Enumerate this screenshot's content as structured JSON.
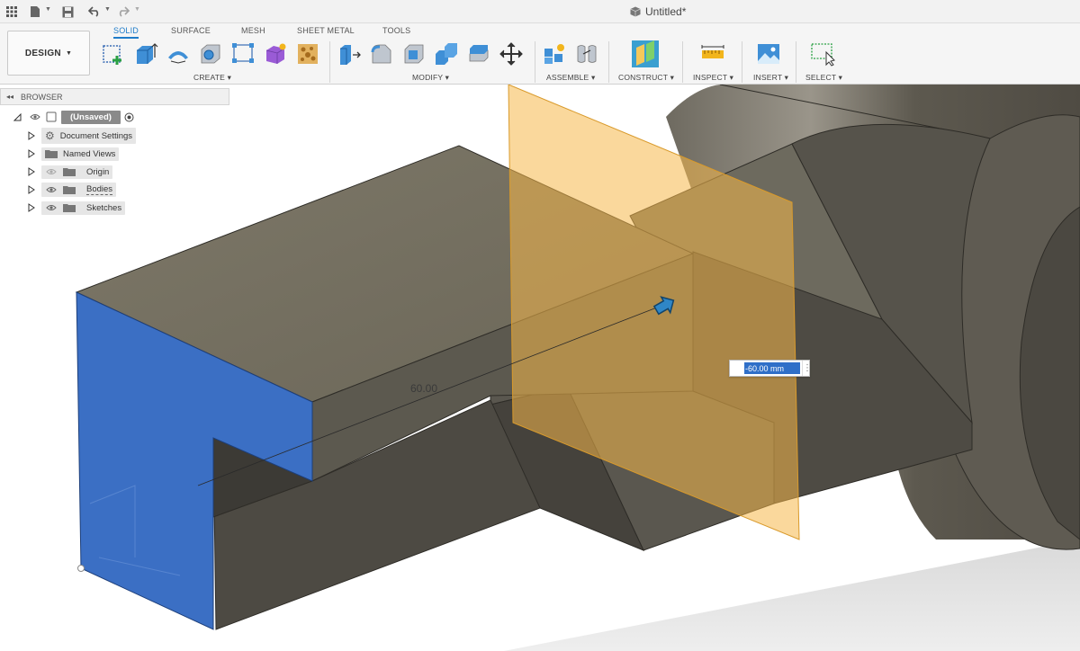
{
  "titlebar": {
    "document_title": "Untitled*"
  },
  "toolbar": {
    "workspace_label": "DESIGN",
    "tabs": [
      "SOLID",
      "SURFACE",
      "MESH",
      "SHEET METAL",
      "TOOLS"
    ],
    "groups": {
      "create": "CREATE",
      "modify": "MODIFY",
      "assemble": "ASSEMBLE",
      "construct": "CONSTRUCT",
      "inspect": "INSPECT",
      "insert": "INSERT",
      "select": "SELECT"
    },
    "accent_color": "#1f7cc9"
  },
  "browser": {
    "title": "BROWSER",
    "root_label": "(Unsaved)",
    "items": [
      {
        "label": "Document Settings",
        "icon": "gear-icon"
      },
      {
        "label": "Named Views",
        "icon": "folder-icon"
      },
      {
        "label": "Origin",
        "icon": "folder-icon"
      },
      {
        "label": "Bodies",
        "icon": "folder-icon"
      },
      {
        "label": "Sketches",
        "icon": "folder-icon"
      }
    ]
  },
  "viewport": {
    "dimension_text": "60.00",
    "dimension_input_value": "-60.00 mm",
    "profile_color": "#3b6fc4",
    "plane_color": "#f5b84a"
  }
}
